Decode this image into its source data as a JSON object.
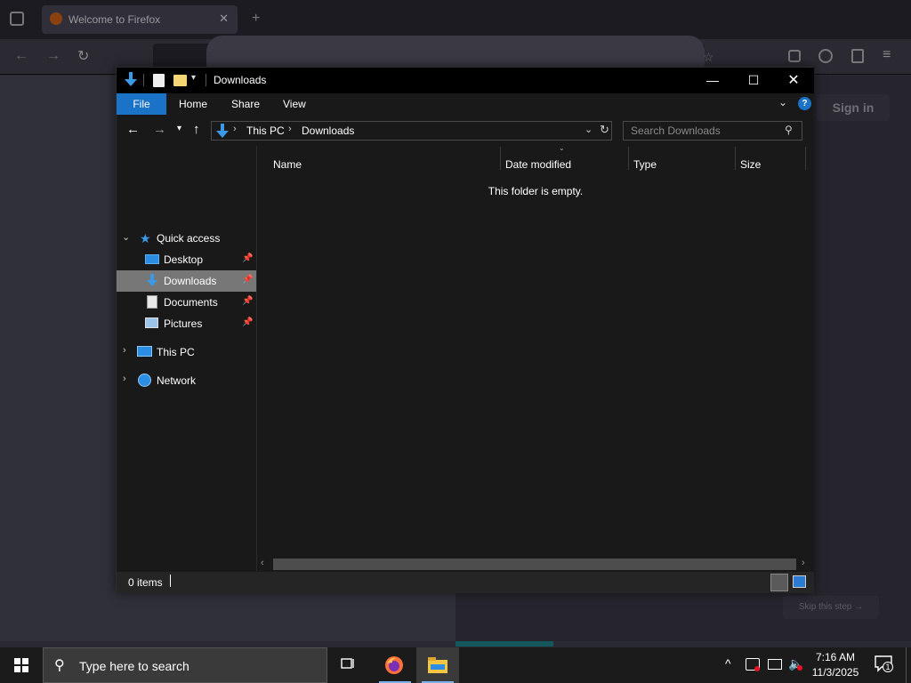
{
  "firefox": {
    "tab_title": "Welcome to Firefox",
    "tab_close": "✕",
    "new_tab": "+",
    "sign_in": "Sign in",
    "skip_step": "Skip this step →"
  },
  "explorer": {
    "title": "Downloads",
    "window_controls": {
      "minimize": "—",
      "maximize": "☐",
      "close": "✕"
    },
    "ribbon": {
      "file": "File",
      "home": "Home",
      "share": "Share",
      "view": "View",
      "expand": "⌄",
      "help": "?"
    },
    "address": {
      "path": [
        "This PC",
        "Downloads"
      ],
      "separator": "›"
    },
    "search": {
      "placeholder": "Search Downloads"
    },
    "nav_pane": {
      "quick_access": "Quick access",
      "quick_items": [
        {
          "label": "Desktop",
          "icon": "desktop-icon"
        },
        {
          "label": "Downloads",
          "icon": "downloads-icon",
          "selected": true
        },
        {
          "label": "Documents",
          "icon": "documents-icon"
        },
        {
          "label": "Pictures",
          "icon": "pictures-icon"
        }
      ],
      "this_pc": "This PC",
      "network": "Network"
    },
    "columns": [
      "Name",
      "Date modified",
      "Type",
      "Size"
    ],
    "empty_message": "This folder is empty.",
    "status": "0 items"
  },
  "taskbar": {
    "search_placeholder": "Type here to search",
    "time": "7:16 AM",
    "date": "11/3/2025",
    "notifications": "1"
  },
  "colors": {
    "accent": "#1a73c6",
    "selected_nav": "#777777",
    "window_bg": "#191919",
    "firefox_bg": "#2b2a33"
  }
}
